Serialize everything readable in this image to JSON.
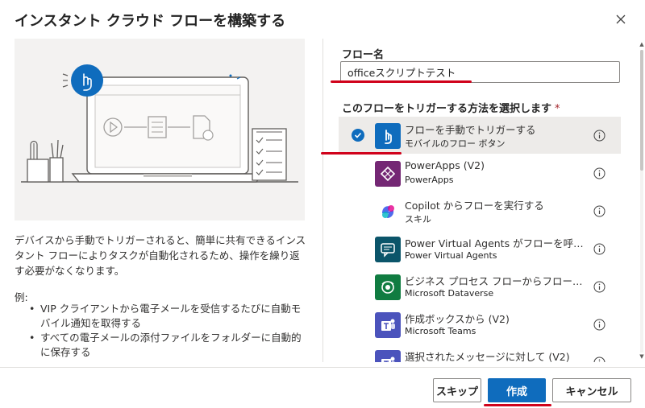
{
  "dialog": {
    "title": "インスタント クラウド フローを構築する",
    "close_icon": "close-icon"
  },
  "left": {
    "description": "デバイスから手動でトリガーされると、簡単に共有できるインスタント フローによりタスクが自動化されるため、操作を繰り返す必要がなくなります。",
    "examples_label": "例:",
    "examples": [
      "VIP クライアントから電子メールを受信するたびに自動モバイル通知を取得する",
      "すべての電子メールの添付ファイルをフォルダーに自動的に保存する"
    ]
  },
  "form": {
    "flow_name_label": "フロー名",
    "flow_name_value": "officeスクリプトテスト",
    "trigger_label": "このフローをトリガーする方法を選択します",
    "required_mark": "*"
  },
  "triggers": [
    {
      "title": "フローを手動でトリガーする",
      "subtitle": "モバイルのフロー ボタン",
      "icon": "touch-icon",
      "color": "#0f6cbd",
      "selected": true
    },
    {
      "title": "PowerApps (V2)",
      "subtitle": "PowerApps",
      "icon": "powerapps-icon",
      "color": "#742774",
      "selected": false
    },
    {
      "title": "Copilot からフローを実行する",
      "subtitle": "スキル",
      "icon": "copilot-icon",
      "color": "#ffffff",
      "selected": false
    },
    {
      "title": "Power Virtual Agents がフローを呼び出したとき",
      "subtitle": "Power Virtual Agents",
      "icon": "virtual-agents-icon",
      "color": "#0b556a",
      "selected": false
    },
    {
      "title": "ビジネス プロセス フローからフローを実行する",
      "subtitle": "Microsoft Dataverse",
      "icon": "dataverse-icon",
      "color": "#107c41",
      "selected": false
    },
    {
      "title": "作成ボックスから (V2)",
      "subtitle": "Microsoft Teams",
      "icon": "teams-icon",
      "color": "#4b53bc",
      "selected": false
    },
    {
      "title": "選択されたメッセージに対して (V2)",
      "subtitle": "",
      "icon": "teams-icon",
      "color": "#4b53bc",
      "selected": false
    }
  ],
  "footer": {
    "skip_label": "スキップ",
    "create_label": "作成",
    "cancel_label": "キャンセル"
  },
  "colors": {
    "primary": "#0f6cbd",
    "annotation_red": "#d0021b"
  }
}
